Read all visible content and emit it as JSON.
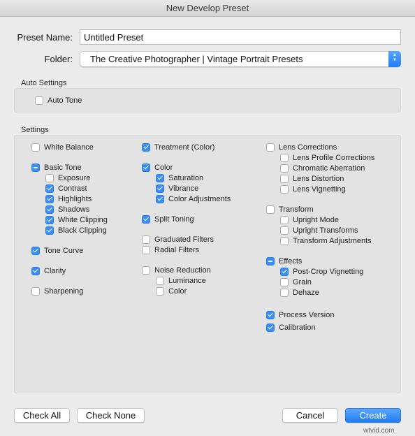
{
  "window": {
    "title": "New Develop Preset"
  },
  "preset_name": {
    "label": "Preset Name:",
    "value": "Untitled Preset"
  },
  "folder": {
    "label": "Folder:",
    "value": "The Creative Photographer | Vintage Portrait Presets"
  },
  "auto_settings": {
    "title": "Auto Settings",
    "auto_tone": {
      "label": "Auto Tone",
      "state": "unchecked"
    }
  },
  "settings": {
    "title": "Settings",
    "col1": [
      {
        "label": "White Balance",
        "state": "unchecked",
        "level": 0
      },
      {
        "label": "Basic Tone",
        "state": "mixed",
        "level": 0
      },
      {
        "label": "Exposure",
        "state": "unchecked",
        "level": 1
      },
      {
        "label": "Contrast",
        "state": "checked",
        "level": 1
      },
      {
        "label": "Highlights",
        "state": "checked",
        "level": 1
      },
      {
        "label": "Shadows",
        "state": "checked",
        "level": 1
      },
      {
        "label": "White Clipping",
        "state": "checked",
        "level": 1
      },
      {
        "label": "Black Clipping",
        "state": "checked",
        "level": 1
      },
      {
        "label": "Tone Curve",
        "state": "checked",
        "level": 0
      },
      {
        "label": "Clarity",
        "state": "checked",
        "level": 0
      },
      {
        "label": "Sharpening",
        "state": "unchecked",
        "level": 0
      }
    ],
    "col2": [
      {
        "label": "Treatment (Color)",
        "state": "checked",
        "level": 0
      },
      {
        "label": "Color",
        "state": "checked",
        "level": 0
      },
      {
        "label": "Saturation",
        "state": "checked",
        "level": 1
      },
      {
        "label": "Vibrance",
        "state": "checked",
        "level": 1
      },
      {
        "label": "Color Adjustments",
        "state": "checked",
        "level": 1
      },
      {
        "label": "Split Toning",
        "state": "checked",
        "level": 0
      },
      {
        "label": "Graduated Filters",
        "state": "unchecked",
        "level": 0
      },
      {
        "label": "Radial Filters",
        "state": "unchecked",
        "level": 0
      },
      {
        "label": "Noise Reduction",
        "state": "unchecked",
        "level": 0
      },
      {
        "label": "Luminance",
        "state": "unchecked",
        "level": 1
      },
      {
        "label": "Color",
        "state": "unchecked",
        "level": 1
      }
    ],
    "col3": [
      {
        "label": "Lens Corrections",
        "state": "unchecked",
        "level": 0
      },
      {
        "label": "Lens Profile Corrections",
        "state": "unchecked",
        "level": 1
      },
      {
        "label": "Chromatic Aberration",
        "state": "unchecked",
        "level": 1
      },
      {
        "label": "Lens Distortion",
        "state": "unchecked",
        "level": 1
      },
      {
        "label": "Lens Vignetting",
        "state": "unchecked",
        "level": 1
      },
      {
        "label": "Transform",
        "state": "unchecked",
        "level": 0
      },
      {
        "label": "Upright Mode",
        "state": "unchecked",
        "level": 1
      },
      {
        "label": "Upright Transforms",
        "state": "unchecked",
        "level": 1
      },
      {
        "label": "Transform Adjustments",
        "state": "unchecked",
        "level": 1
      },
      {
        "label": "Effects",
        "state": "mixed",
        "level": 0
      },
      {
        "label": "Post-Crop Vignetting",
        "state": "checked",
        "level": 1
      },
      {
        "label": "Grain",
        "state": "unchecked",
        "level": 1
      },
      {
        "label": "Dehaze",
        "state": "unchecked",
        "level": 1
      },
      {
        "label": "Process Version",
        "state": "checked",
        "level": 0
      },
      {
        "label": "Calibration",
        "state": "checked",
        "level": 0
      }
    ]
  },
  "buttons": {
    "check_all": "Check All",
    "check_none": "Check None",
    "cancel": "Cancel",
    "create": "Create"
  },
  "watermark": "wtvid.com",
  "colors": {
    "accent": "#3a8ef7",
    "panel": "#e3e3e3",
    "window": "#ececec"
  }
}
